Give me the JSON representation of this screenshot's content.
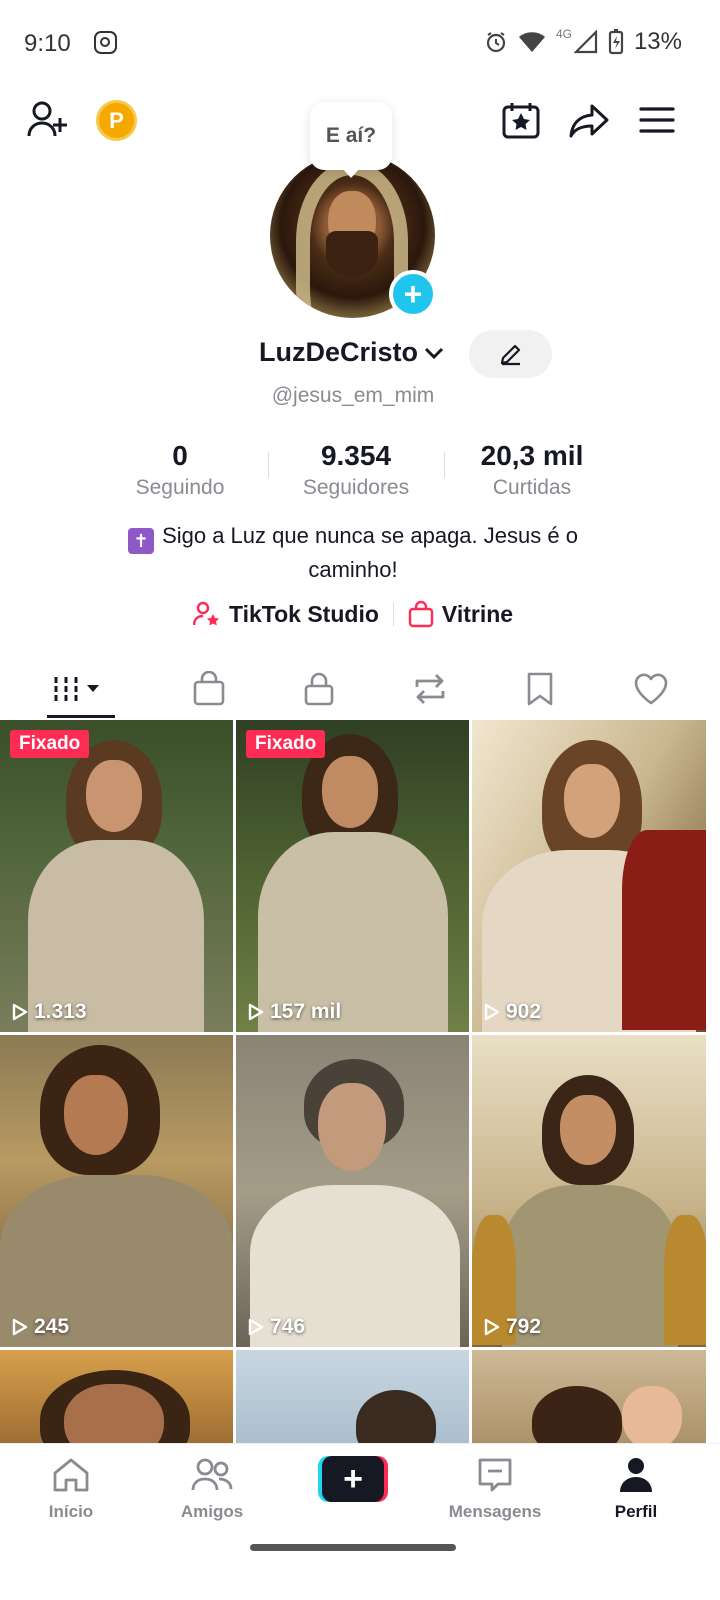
{
  "status_bar": {
    "time": "9:10",
    "network": "4G",
    "battery": "13%"
  },
  "header": {
    "points_badge": "P"
  },
  "profile": {
    "greeting_bubble": "E aí?",
    "display_name": "LuzDeCristo",
    "username": "@jesus_em_mim",
    "stats": [
      {
        "value": "0",
        "label": "Seguindo"
      },
      {
        "value": "9.354",
        "label": "Seguidores"
      },
      {
        "value": "20,3 mil",
        "label": "Curtidas"
      }
    ],
    "bio_line1": "Sigo a Luz que nunca se apaga. Jesus é o",
    "bio_line2": "caminho!",
    "links": {
      "studio": "TikTok Studio",
      "showcase": "Vitrine"
    }
  },
  "tabs": [
    "videos-grid",
    "shop",
    "private",
    "reposts",
    "favorites",
    "liked"
  ],
  "videos": [
    {
      "pinned_label": "Fixado",
      "views": "1.313"
    },
    {
      "pinned_label": "Fixado",
      "views": "157 mil"
    },
    {
      "views": "902"
    },
    {
      "views": "245"
    },
    {
      "views": "746"
    },
    {
      "views": "792"
    },
    {
      "views": ""
    },
    {
      "views": ""
    },
    {
      "views": ""
    }
  ],
  "bottom_nav": {
    "home": "Início",
    "friends": "Amigos",
    "create": "+",
    "messages": "Mensagens",
    "profile": "Perfil"
  },
  "colors": {
    "accent": "#fe2c55",
    "cyan": "#20c5ee",
    "text": "#161823",
    "muted": "#8a8b91"
  }
}
